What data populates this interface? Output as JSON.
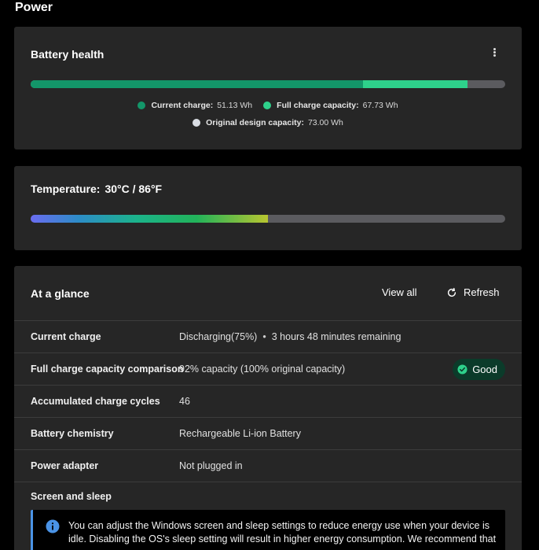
{
  "page": {
    "title": "Power"
  },
  "battery_health": {
    "title": "Battery health",
    "current_charge_fraction": 0.7,
    "full_charge_fraction": 0.92,
    "legend": {
      "current_label": "Current charge:",
      "current_value": "51.13 Wh",
      "full_label": "Full charge capacity:",
      "full_value": "67.73 Wh",
      "design_label": "Original design capacity:",
      "design_value": "73.00 Wh"
    },
    "colors": {
      "current": "#139669",
      "full": "#2ed18b",
      "design": "#d9dde3",
      "track": "#5b5b5f"
    }
  },
  "temperature": {
    "label": "Temperature:",
    "value": "30°C / 86°F",
    "fill_fraction": 0.5
  },
  "glance": {
    "title": "At a glance",
    "view_all_label": "View all",
    "refresh_label": "Refresh",
    "rows": [
      {
        "label": "Current charge",
        "value": "Discharging(75%)",
        "extra": "3 hours 48 minutes remaining"
      },
      {
        "label": "Full charge capacity comparison",
        "value": "92% capacity (100% original capacity)",
        "badge": "Good"
      },
      {
        "label": "Accumulated charge cycles",
        "value": "46"
      },
      {
        "label": "Battery chemistry",
        "value": "Rechargeable Li-ion Battery"
      },
      {
        "label": "Power adapter",
        "value": "Not plugged in"
      },
      {
        "label": "Screen and sleep"
      }
    ],
    "info_text": "You can adjust the Windows screen and sleep settings to reduce energy use when your device is idle. Disabling the OS's sleep setting will result in higher energy consumption. We recommend that",
    "colors": {
      "good_badge_bg": "#0b3b2a",
      "good_icon": "#2ed18b",
      "info_accent": "#4a93e6"
    }
  }
}
